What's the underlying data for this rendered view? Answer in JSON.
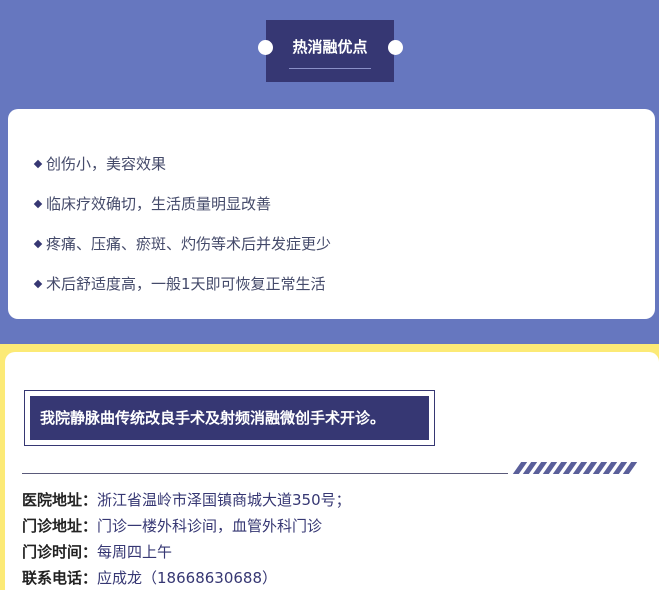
{
  "header": {
    "title": "热消融优点"
  },
  "benefits": [
    "创伤小，美容效果",
    "临床疗效确切，生活质量明显改善",
    "疼痛、压痛、瘀斑、灼伤等术后并发症更少",
    "术后舒适度高，一般1天即可恢复正常生活"
  ],
  "banner": {
    "text": "我院静脉曲传统改良手术及射频消融微创手术开诊。"
  },
  "info": [
    {
      "label": "医院地址：",
      "value": "浙江省温岭市泽国镇商城大道350号；"
    },
    {
      "label": "门诊地址：",
      "value": "门诊一楼外科诊间，血管外科门诊"
    },
    {
      "label": "门诊时间：",
      "value": "每周四上午"
    },
    {
      "label": "联系电话：",
      "value": "应成龙（18668630688）"
    }
  ],
  "colors": {
    "top_background": "#6677bf",
    "accent_navy": "#363773",
    "bottom_background": "#fcea76"
  }
}
